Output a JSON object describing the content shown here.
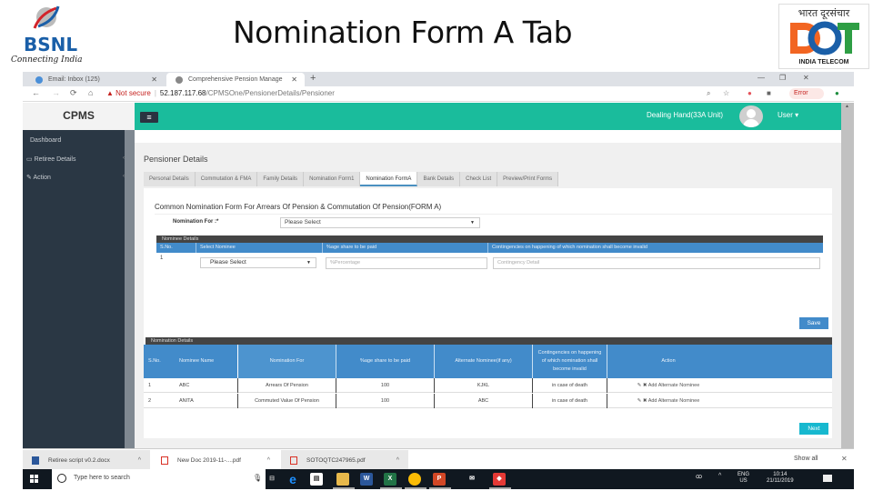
{
  "slide": {
    "title": "Nomination Form A Tab",
    "left_logo": {
      "name": "BSNL",
      "tagline": "Connecting India"
    },
    "right_logo": {
      "hindi": "भारत दूरसंचार",
      "mark": "DOT",
      "subtitle": "INDIA TELECOM"
    }
  },
  "browser": {
    "tabs": [
      {
        "label": "Email: Inbox (125)",
        "active": false
      },
      {
        "label": "Comprehensive Pension Manage",
        "active": true
      }
    ],
    "new_tab": "+",
    "window_controls": {
      "minimize": "—",
      "restore": "❐",
      "close": "✕"
    },
    "nav": {
      "back": "←",
      "forward": "→",
      "reload": "⟳",
      "home": "⌂"
    },
    "security_label": "Not secure",
    "url_host": "52.187.117.68",
    "url_path": "/CPMSOne/PensionerDetails/Pensioner",
    "error_badge": "Error"
  },
  "app": {
    "brand": "CPMS",
    "menu_toggle": "≡",
    "role_label": "Dealing Hand(33A Unit)",
    "user_menu": "User ▾",
    "colors": {
      "topbar": "#1abc9c",
      "sidebar": "#2a3744",
      "table_header": "#428bca",
      "next_button": "#17b8cf"
    },
    "sidebar": [
      {
        "label": "Dashboard",
        "icon": ""
      },
      {
        "label": "Retiree Details",
        "icon": "id-card-icon",
        "glyph": "▭"
      },
      {
        "label": "Action",
        "icon": "edit-icon",
        "glyph": "✎"
      }
    ],
    "page_heading": "Pensioner Details",
    "tabs": [
      {
        "label": "Personal Details",
        "active": false
      },
      {
        "label": "Commutation & FMA",
        "active": false
      },
      {
        "label": "Family Details",
        "active": false
      },
      {
        "label": "Nomination Form1",
        "active": false
      },
      {
        "label": "Nomination FormA",
        "active": true
      },
      {
        "label": "Bank Details",
        "active": false
      },
      {
        "label": "Check List",
        "active": false
      },
      {
        "label": "Preview/Print Forms",
        "active": false
      }
    ],
    "form": {
      "title": "Common Nomination Form For Arrears Of Pension & Commutation Of Pension(FORM A)",
      "nomination_for_label": "Nomination For :*",
      "nomination_for_value": "Please Select",
      "nominee_section": "Nominee Details",
      "nominee_columns": [
        "S.No.",
        "Select Nominee",
        "%age share to be paid",
        "Contingencies on happening of which nomination shall become invalid"
      ],
      "nominee_row": {
        "sno": "1",
        "select_value": "Please Select",
        "share_placeholder": "%Percentage",
        "contingency_placeholder": "Contingency Detail"
      },
      "save_label": "Save"
    },
    "nomination_details": {
      "section": "Nomination Details",
      "columns": [
        "S.No.",
        "Nominee Name",
        "Nomination For",
        "%age share to be paid",
        "Alternate Nominee(if any)",
        "Contingencies on happening of which nomination shall become invalid",
        "Action"
      ],
      "rows": [
        {
          "sno": "1",
          "name": "ABC",
          "for": "Arrears Of Pension",
          "share": "100",
          "alternate": "KJKL",
          "contingency": "in case of death",
          "action": "✎ ✖ Add Alternate Nominee"
        },
        {
          "sno": "2",
          "name": "ANITA",
          "for": "Commuted Value Of Pension",
          "share": "100",
          "alternate": "ABC",
          "contingency": "in case of death",
          "action": "✎ ✖ Add Alternate Nominee"
        }
      ],
      "next_label": "Next"
    }
  },
  "downloads": {
    "items": [
      {
        "name": "Retiree script v0.2.docx",
        "type": "docx"
      },
      {
        "name": "New Doc 2019-11-....pdf",
        "type": "pdf"
      },
      {
        "name": "SOTOQTC247965.pdf",
        "type": "pdf"
      }
    ],
    "show_all": "Show all",
    "close": "✕"
  },
  "taskbar": {
    "search_placeholder": "Type here to search",
    "apps": [
      "task-view",
      "edge",
      "store",
      "file-explorer",
      "word",
      "excel",
      "chrome",
      "powerpoint",
      "mail",
      "anydesk"
    ],
    "lang_top": "ENG",
    "lang_bottom": "US",
    "time": "10:14",
    "date": "21/11/2019"
  }
}
